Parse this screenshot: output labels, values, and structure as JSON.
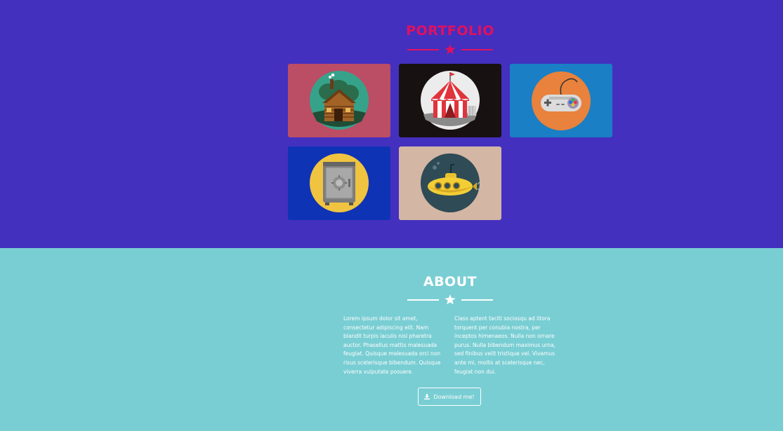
{
  "portfolio": {
    "title": "PORTFOLIO",
    "items": [
      {
        "name": "cabin",
        "bg": "#bb4d65"
      },
      {
        "name": "circus-tent",
        "bg": "#181111"
      },
      {
        "name": "game-controller",
        "bg": "#1a7fc4"
      },
      {
        "name": "safe",
        "bg": "#0f33b5"
      },
      {
        "name": "submarine",
        "bg": "#d4b6a4"
      }
    ]
  },
  "about": {
    "title": "ABOUT",
    "col1": "Lorem ipsum dolor sit amet, consectetur adipiscing elit. Nam blandit turpis iaculis nisl pharetra auctor. Phasellus mattis malesuada feugiat. Quisque malesuada orci non risus scelerisque bibendum. Quisque viverra vulputate posuere.",
    "col2": "Class aptent taciti sociosqu ad litora torquent per conubia nostra, per inceptos himenaeos. Nulla non ornare purus. Nulla bibendum maximus urna, sed finibus velit tristique vel. Vivamus ante mi, mollis at scelerisque nec, feugiat non dui.",
    "button_label": "Download me!"
  },
  "colors": {
    "portfolio_bg": "#4330bf",
    "about_bg": "#79ced3",
    "accent": "#e0115f"
  }
}
